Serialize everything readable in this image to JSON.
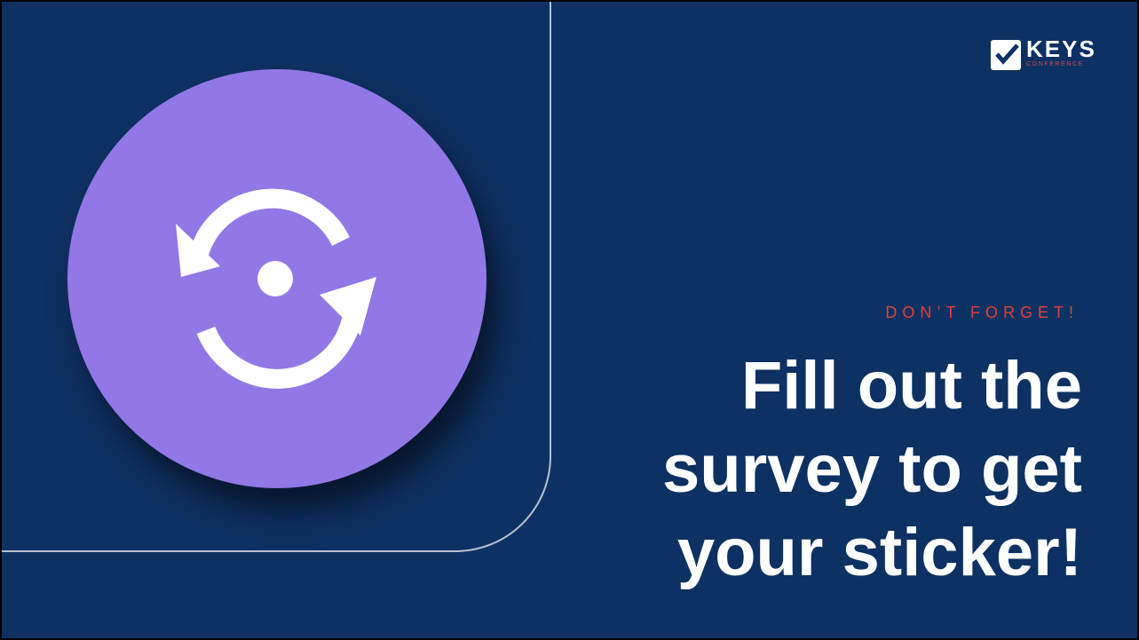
{
  "slide": {
    "eyebrow": "DON’T FORGET!",
    "headline_lines": [
      "Fill out the",
      "survey to get",
      "your sticker!"
    ]
  },
  "logo": {
    "icon": "checkbox-check-icon",
    "main": "KEYS",
    "sub": "CONFERENCE"
  },
  "hero": {
    "icon": "sync-refresh-icon"
  },
  "colors": {
    "background": "#0e3163",
    "circle": "#9277e6",
    "eyebrow": "#e0413a",
    "headline": "#ffffff",
    "outline": "#b9c1cf"
  }
}
